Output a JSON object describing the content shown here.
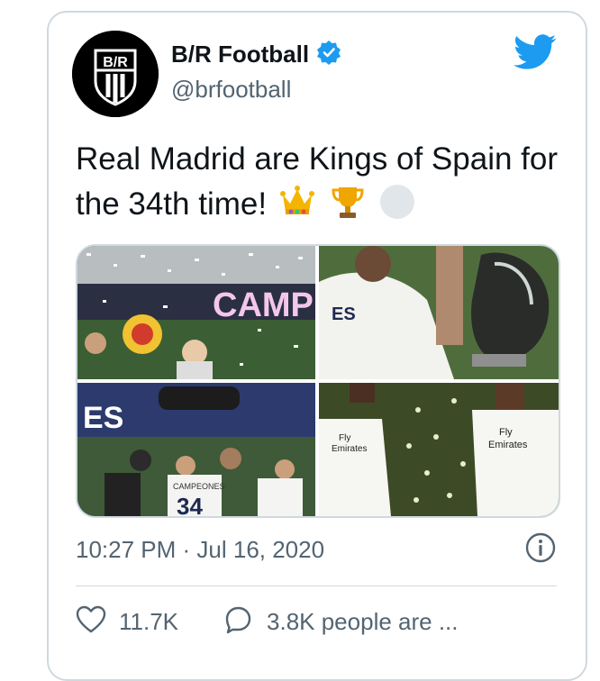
{
  "colors": {
    "brand_blue": "#1d9bf0",
    "text_primary": "#0f1419",
    "text_secondary": "#536471",
    "border": "#cfd9de"
  },
  "author": {
    "display_name": "B/R Football",
    "handle": "@brfootball",
    "verified": true,
    "avatar_text": "B/R"
  },
  "tweet": {
    "text": "Real Madrid are Kings of Spain for the 34th time!",
    "emojis": [
      "crown-emoji",
      "trophy-emoji",
      "white-circle-emoji"
    ]
  },
  "media": {
    "photos": [
      {
        "name": "celebration-confetti-photo",
        "banner_text": "CAMPEO"
      },
      {
        "name": "player-kissing-trophy-photo",
        "shirt_text": "ES"
      },
      {
        "name": "players-tossing-coach-photo",
        "shirt_text": "CAMPEONES",
        "shirt_number": "34"
      },
      {
        "name": "players-white-kits-photo",
        "sponsor_top": "Fly",
        "sponsor_bottom": "Emirates"
      }
    ]
  },
  "meta": {
    "timestamp": "10:27 PM · Jul 16, 2020",
    "info_icon": "info-icon"
  },
  "actions": {
    "like_count": "11.7K",
    "reply_label": "3.8K people are ..."
  }
}
